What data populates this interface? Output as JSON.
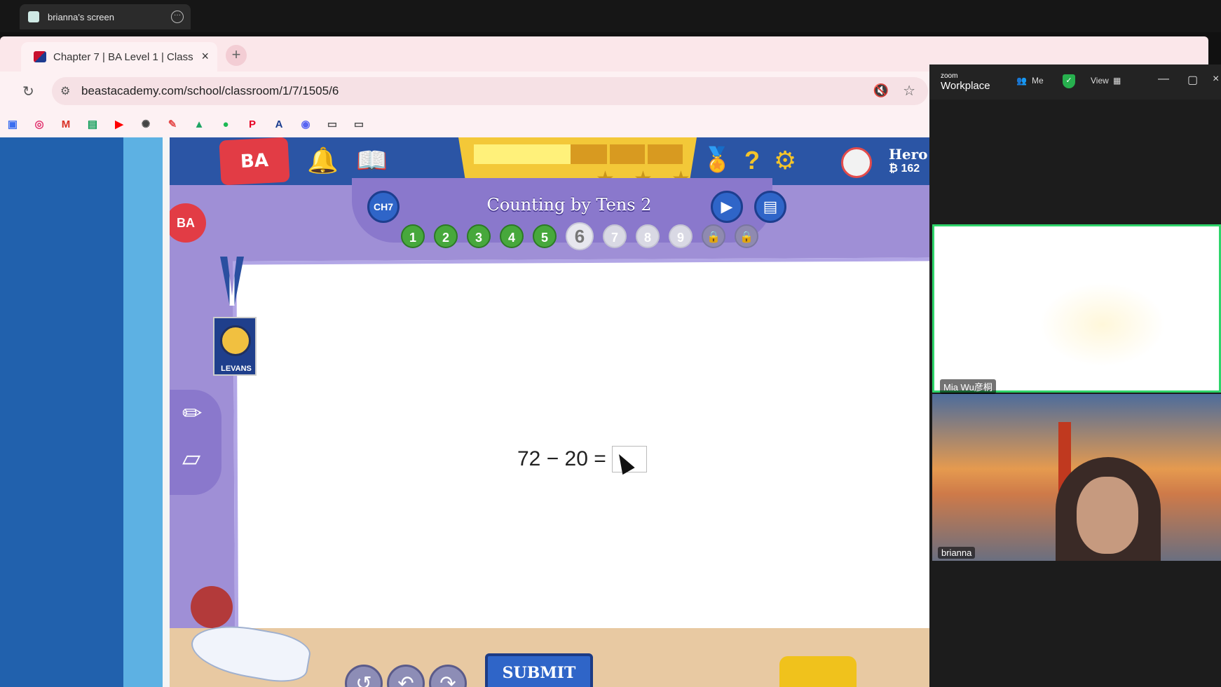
{
  "zoom_share": {
    "tab_label": "brianna's screen"
  },
  "browser": {
    "tab_title": "Chapter 7 | BA Level 1 | Class",
    "url": "beastacademy.com/school/classroom/1/7/1505/6",
    "bookmarks": [
      "calendar-icon",
      "instagram-icon",
      "gmail-icon",
      "classroom-icon",
      "youtube-icon",
      "chatgpt-icon",
      "pen-icon",
      "drive-icon",
      "spotify-icon",
      "pinterest-icon",
      "font-icon",
      "discord-icon",
      "folder-icon",
      "folder-icon"
    ]
  },
  "game": {
    "logo": "BA",
    "lesson_title": "Counting by Tens 2",
    "chapter_button": "CH7",
    "hero_name": "Hero",
    "hero_coins": "₿ 162",
    "problems": [
      {
        "label": "1",
        "state": "done"
      },
      {
        "label": "2",
        "state": "done"
      },
      {
        "label": "3",
        "state": "done"
      },
      {
        "label": "4",
        "state": "done"
      },
      {
        "label": "5",
        "state": "done"
      },
      {
        "label": "6",
        "state": "current"
      },
      {
        "label": "7",
        "state": "todo"
      },
      {
        "label": "8",
        "state": "todo"
      },
      {
        "label": "9",
        "state": "todo"
      },
      {
        "label": "🔒",
        "state": "locked"
      },
      {
        "label": "🔒",
        "state": "locked"
      }
    ],
    "badge_text": "LEVANS",
    "equation": "72 − 20 =",
    "submit_label": "SUBMIT",
    "progress_fill": 0.4,
    "colors": {
      "accent": "#2f65c8",
      "done": "#47a83c",
      "brand_red": "#e23c45"
    }
  },
  "zoom": {
    "brand_top": "zoom",
    "brand_bottom": "Workplace",
    "meeting_item": "Me",
    "view_label": "View",
    "participants": [
      {
        "name": "Mia  Wu彦桐"
      },
      {
        "name": "brianna"
      }
    ]
  }
}
